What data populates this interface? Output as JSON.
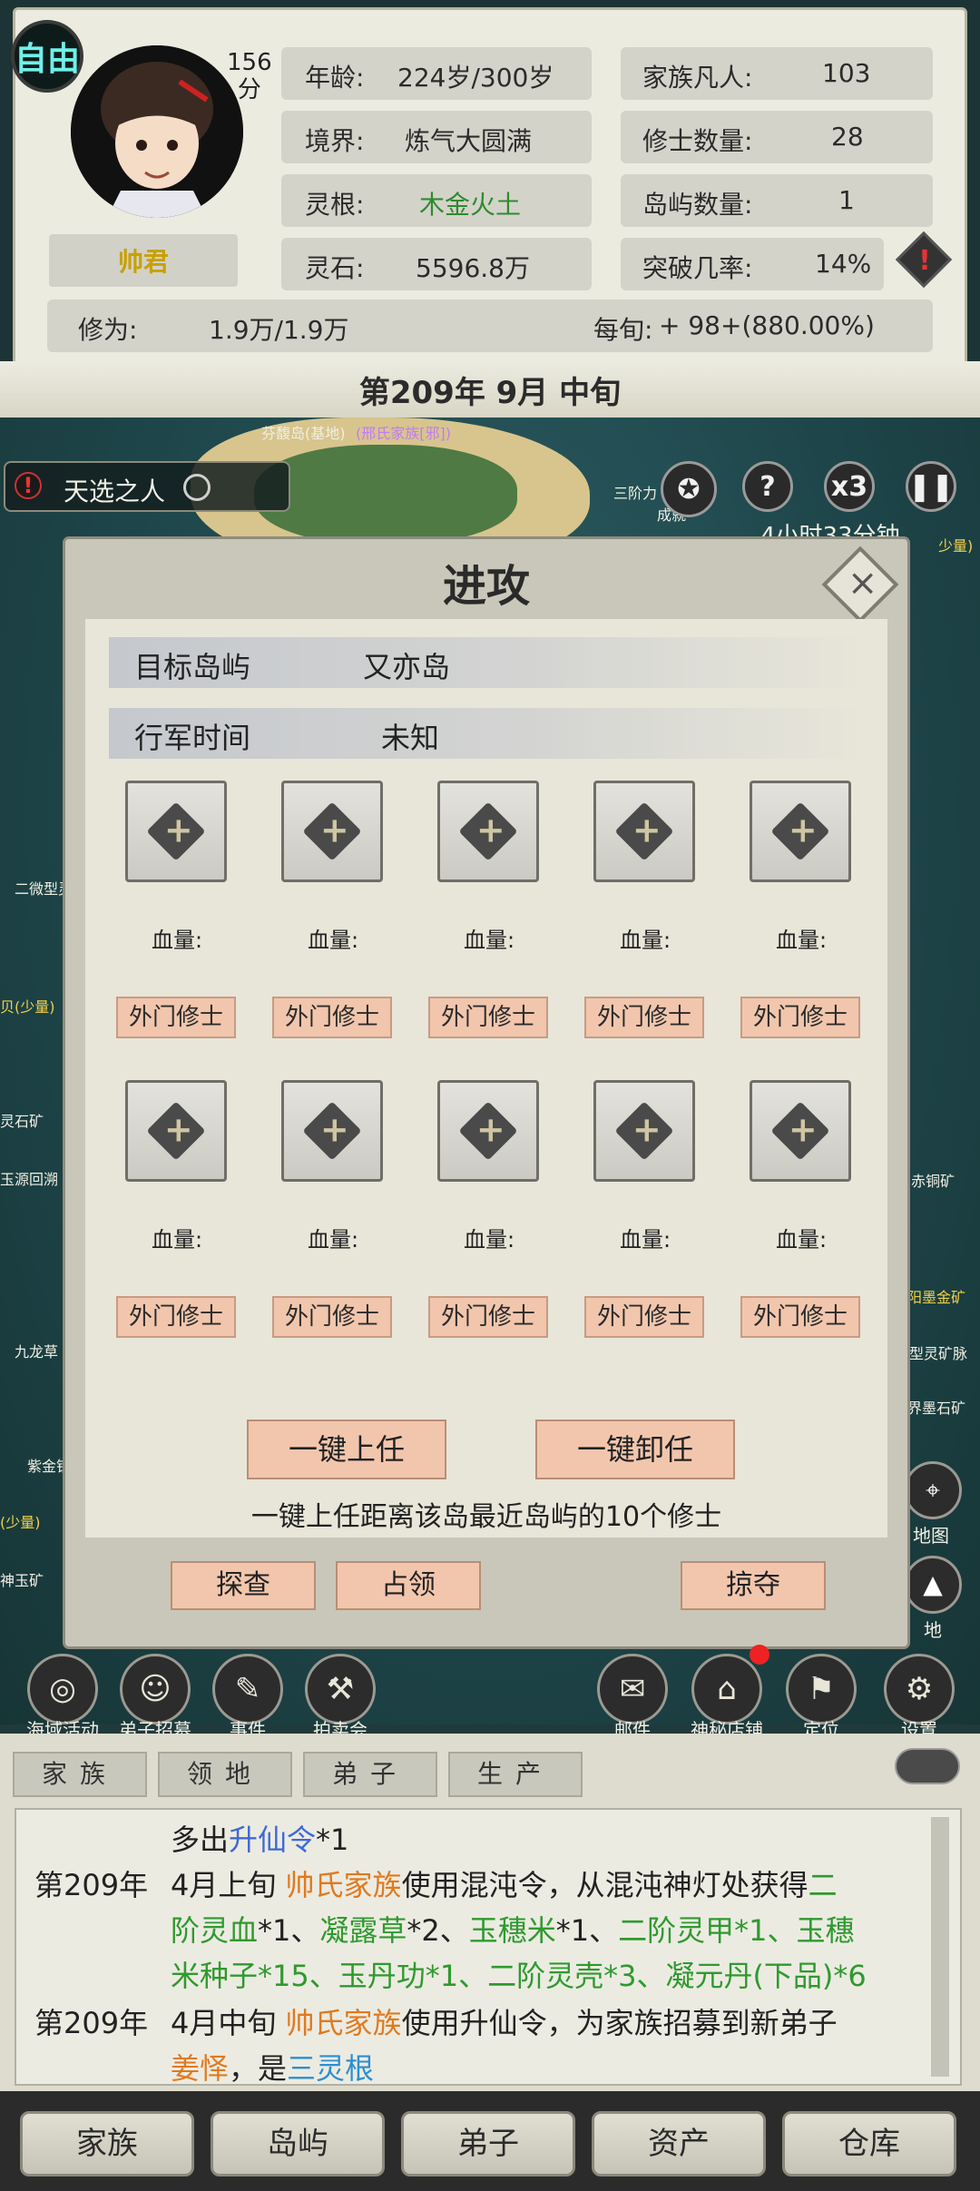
{
  "status": {
    "free_badge": "自由",
    "score_value": "156",
    "score_unit": "分",
    "player_name": "帅君",
    "age_label": "年龄:",
    "age_value": "224岁/300岁",
    "realm_label": "境界:",
    "realm_value": "炼气大圆满",
    "root_label": "灵根:",
    "root_value": "木金火土",
    "stone_label": "灵石:",
    "stone_value": "5596.8万",
    "family_label": "家族凡人:",
    "family_value": "103",
    "cultivator_label": "修士数量:",
    "cultivator_value": "28",
    "island_label": "岛屿数量:",
    "island_value": "1",
    "breakthrough_label": "突破几率:",
    "breakthrough_value": "14%",
    "cultivation_label": "修为:",
    "cultivation_value": "1.9万/1.9万",
    "per_period_label": "每旬:",
    "per_period_value": "+ 98+(880.00%)"
  },
  "date": "第209年 9月 中旬",
  "map": {
    "event_chip": "天选之人",
    "island_label": "芬馥岛(基地)",
    "island_owner": "(邢氏家族[邪])",
    "speed_label": "x3",
    "tier_text": "三阶力",
    "achievement_label": "成就",
    "time_fragment": "4小时33分钟",
    "left_labels": [
      "二微型灵",
      "贝(少量)",
      "灵石矿",
      "玉源回溯",
      "九龙草",
      "紫金钥",
      "(少量)",
      "神玉矿"
    ],
    "right_labels": [
      "少量)",
      "赤铜矿",
      "阳墨金矿",
      "型灵矿脉",
      "界墨石矿"
    ]
  },
  "dialog": {
    "title": "进攻",
    "target_label": "目标岛屿",
    "target_value": "又亦岛",
    "march_label": "行军时间",
    "march_value": "未知",
    "hp_label": "血量:",
    "role_label": "外门修士",
    "assign_all": "一键上任",
    "unassign_all": "一键卸任",
    "hint": "一键上任距离该岛最近岛屿的10个修士",
    "scout": "探查",
    "occupy": "占领",
    "plunder": "掠夺"
  },
  "icon_bar": [
    {
      "label": "海域活动",
      "icon": "sea-activity-icon",
      "glyph": "◎"
    },
    {
      "label": "弟子招募",
      "icon": "recruit-icon",
      "glyph": "☺"
    },
    {
      "label": "事件",
      "icon": "scroll-icon",
      "glyph": "✎"
    },
    {
      "label": "拍卖会",
      "icon": "gavel-icon",
      "glyph": "⚒"
    },
    {
      "label": "邮件",
      "icon": "mail-icon",
      "glyph": "✉"
    },
    {
      "label": "神秘店铺",
      "icon": "shop-icon",
      "glyph": "⌂"
    },
    {
      "label": "定位",
      "icon": "flag-icon",
      "glyph": "⚑"
    },
    {
      "label": "设置",
      "icon": "gear-icon",
      "glyph": "⚙"
    }
  ],
  "side_icons": [
    "地图",
    "地"
  ],
  "log_tabs": [
    "家族",
    "领地",
    "弟子",
    "生产"
  ],
  "log": {
    "line0": "多出",
    "line0_item": "升仙令",
    "line0_tail": "*1",
    "year1": "第209年",
    "line1_a": "4月上旬 ",
    "line1_family": "帅氏家族",
    "line1_b": "使用混沌令，从混沌神灯处获得",
    "line1_c": "二",
    "line2_a": "阶灵血",
    "line2_b": "*1、",
    "line2_c": "凝露草",
    "line2_d": "*2、",
    "line2_e": "玉穗米",
    "line2_f": "*1、",
    "line2_g": "二阶灵甲*1、玉穗",
    "line3": "米种子*15、玉丹功*1、二阶灵壳*3、凝元丹(下品)*6",
    "year2": "第209年",
    "line4_a": "4月中旬 ",
    "line4_family": "帅氏家族",
    "line4_b": "使用升仙令，为家族招募到新弟子",
    "line5_name": "姜怿",
    "line5_b": "，是",
    "line5_root": "三灵根"
  },
  "nav": [
    "家族",
    "岛屿",
    "弟子",
    "资产",
    "仓库"
  ],
  "colors": {
    "accent_orange": "#e07a1f",
    "accent_green": "#2e9a2e",
    "accent_blue": "#3e69d6",
    "name_gold": "#c9a000",
    "button_peach": "#f2c6ad"
  }
}
